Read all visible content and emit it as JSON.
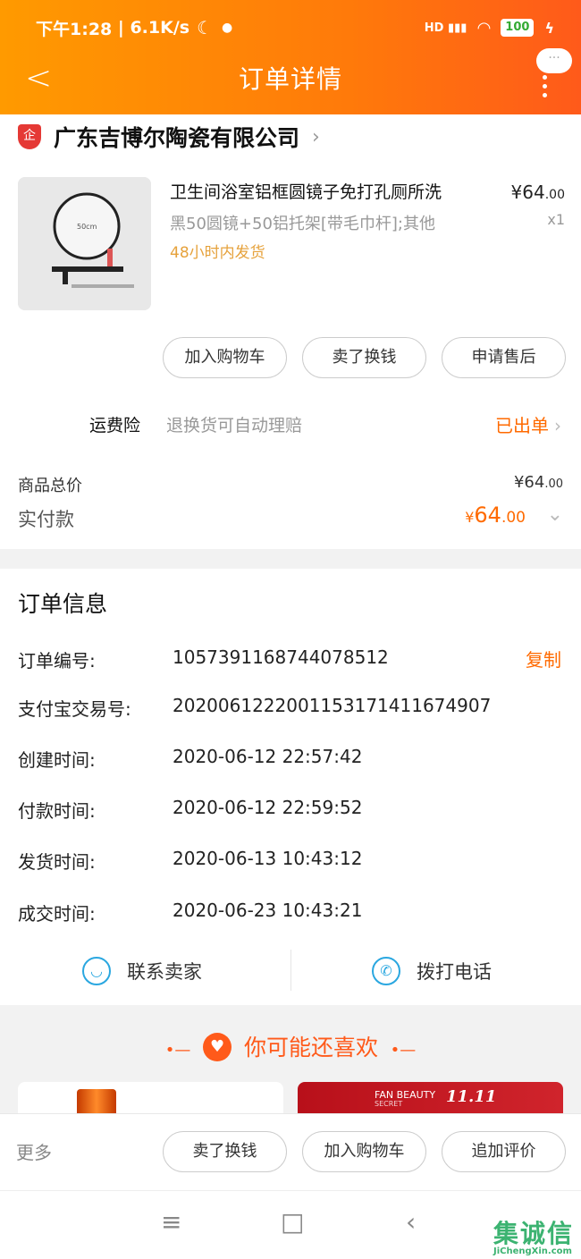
{
  "status_bar": {
    "time": "下午1:28",
    "speed": "6.1K/s",
    "battery": "100",
    "signal": "HD",
    "icons": [
      "moon-icon",
      "signal-icon",
      "wifi-icon",
      "battery-icon",
      "charging-icon"
    ]
  },
  "nav": {
    "title": "订单详情",
    "bubble": "···"
  },
  "shop": {
    "badge": "企",
    "name": "广东吉博尔陶瓷有限公司"
  },
  "product": {
    "title": "卫生间浴室铝框圆镜子免打孔厕所洗",
    "sku": "黑50圆镜+50铝托架[带毛巾杆];其他",
    "shipping": "48小时内发货",
    "price_int": "¥64",
    "price_dec": ".00",
    "qty": "x1",
    "image_label": "50cm"
  },
  "actions": {
    "add_cart": "加入购物车",
    "resell": "卖了换钱",
    "after_sale": "申请售后"
  },
  "insurance": {
    "label": "运费险",
    "desc": "退换货可自动理赔",
    "status": "已出单"
  },
  "totals": {
    "goods_label": "商品总价",
    "goods_int": "¥64",
    "goods_dec": ".00",
    "paid_label": "实付款",
    "paid_yen": "¥",
    "paid_int": "64",
    "paid_dec": ".00"
  },
  "order_info": {
    "title": "订单信息",
    "copy": "复制",
    "rows": [
      {
        "label": "订单编号:",
        "value": "1057391168744078512"
      },
      {
        "label": "支付宝交易号:",
        "value": "2020061222001153171411674907"
      },
      {
        "label": "创建时间:",
        "value": "2020-06-12 22:57:42"
      },
      {
        "label": "付款时间:",
        "value": "2020-06-12 22:59:52"
      },
      {
        "label": "发货时间:",
        "value": "2020-06-13 10:43:12"
      },
      {
        "label": "成交时间:",
        "value": "2020-06-23 10:43:21"
      }
    ]
  },
  "contact": {
    "seller": "联系卖家",
    "call": "拨打电话"
  },
  "recommend": {
    "title": "你可能还喜欢",
    "card2_brand": "FAN BEAUTY",
    "card2_sub": "SECRET",
    "card2_date": "11.11"
  },
  "bottom": {
    "more": "更多",
    "resell": "卖了换钱",
    "add_cart": "加入购物车",
    "review": "追加评价"
  },
  "watermark": {
    "main": "集诚信",
    "sub": "JiChengXin.com"
  },
  "colors": {
    "accent": "#ff6a00",
    "header_start": "#ff9a00",
    "header_end": "#ff5a1a",
    "shipping": "#e6a23c",
    "contact_icon": "#2aa7e0"
  }
}
